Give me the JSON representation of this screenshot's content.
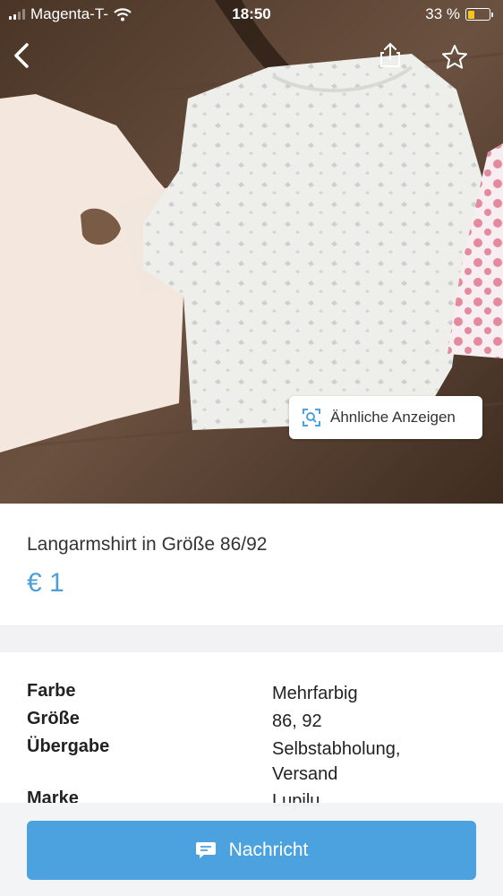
{
  "status_bar": {
    "carrier": "Magenta-T-",
    "time": "18:50",
    "battery": "33 %",
    "battery_level": 0.33
  },
  "nav": {
    "back_icon": "chevron-left-icon",
    "share_icon": "share-icon",
    "favorite_icon": "star-icon"
  },
  "image": {
    "similar_button": "Ähnliche Anzeigen",
    "similar_icon": "image-search-icon"
  },
  "listing": {
    "title": "Langarmshirt in Größe 86/92",
    "price": "€ 1"
  },
  "details": [
    {
      "key": "Farbe",
      "value": "Mehrfarbig"
    },
    {
      "key": "Größe",
      "value": "86, 92"
    },
    {
      "key": "Übergabe",
      "value": "Selbstabholung, Versand"
    },
    {
      "key": "Marke",
      "value": "Lupilu"
    }
  ],
  "actions": {
    "message_button": "Nachricht",
    "message_icon": "chat-bubble-icon"
  },
  "colors": {
    "accent": "#4ca2df",
    "price": "#4d9fd8"
  }
}
